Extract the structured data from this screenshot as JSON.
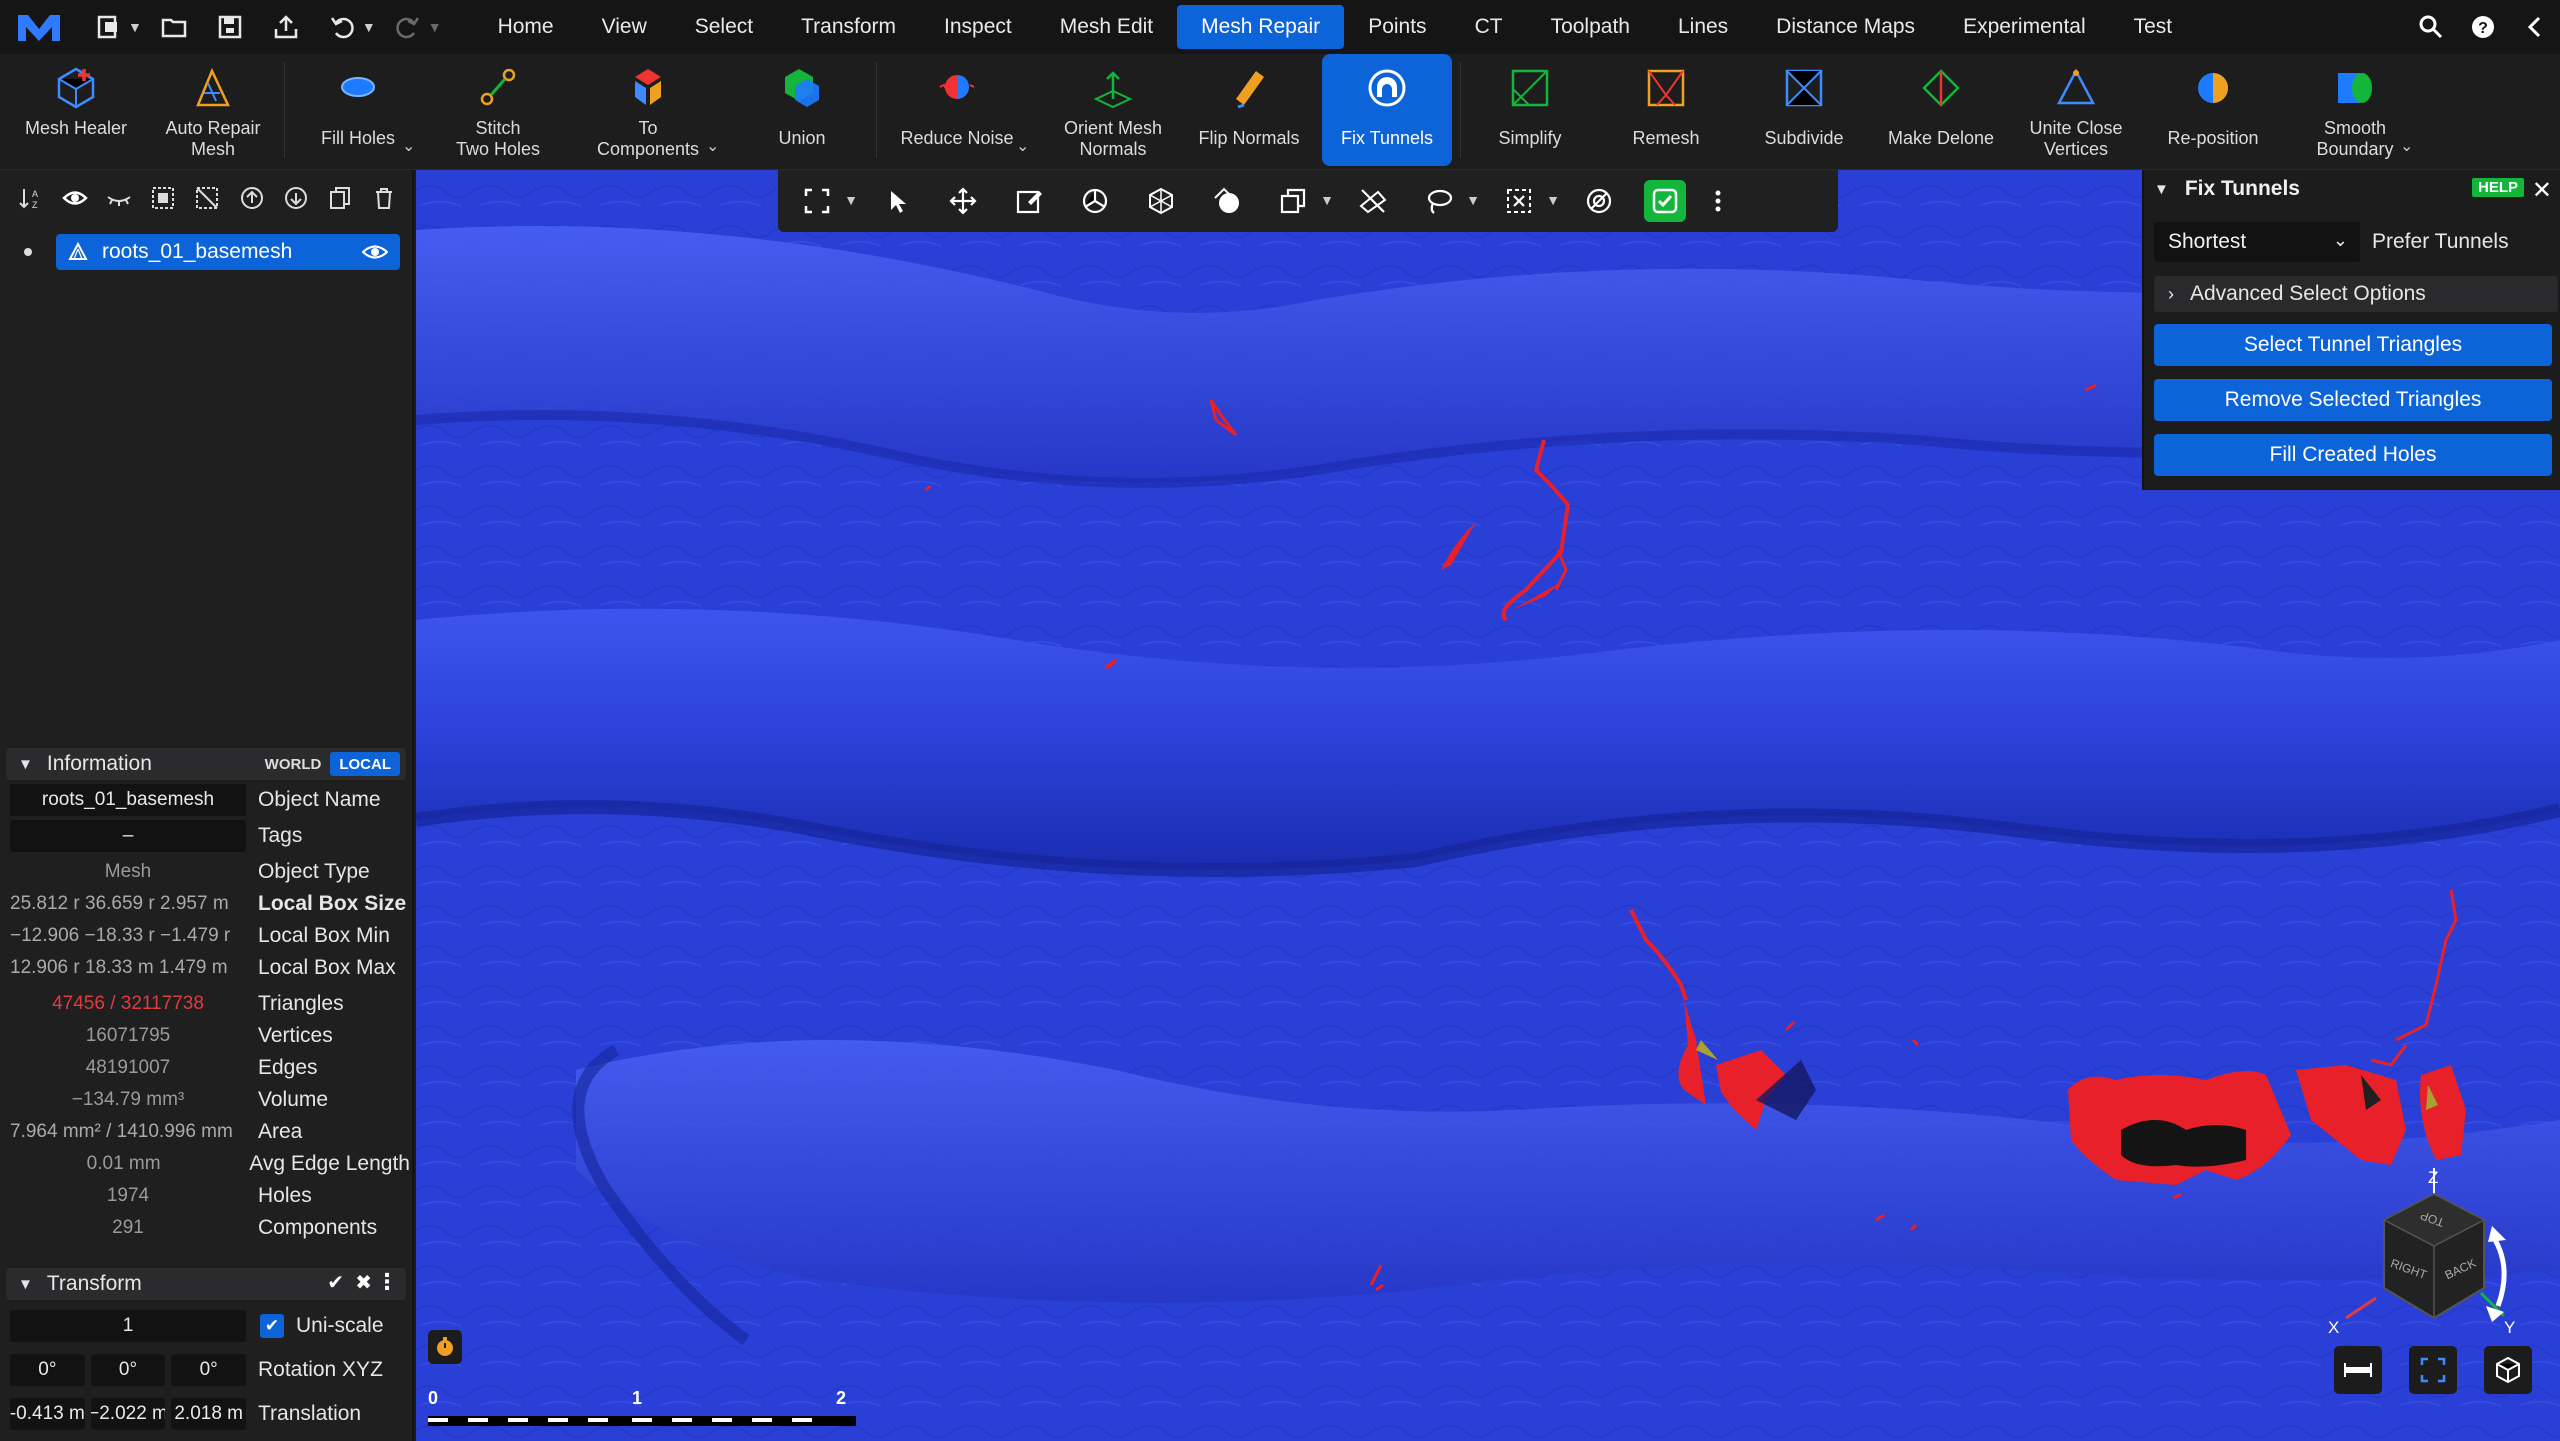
{
  "menubar": {
    "items": [
      "Home",
      "View",
      "Select",
      "Transform",
      "Inspect",
      "Mesh Edit",
      "Mesh Repair",
      "Points",
      "CT",
      "Toolpath",
      "Lines",
      "Distance Maps",
      "Experimental",
      "Test"
    ],
    "active": "Mesh Repair"
  },
  "ribbon": {
    "tools": [
      {
        "label": "Mesh Healer"
      },
      {
        "label": "Auto Repair\nMesh"
      },
      {
        "label": "Fill Holes"
      },
      {
        "label": "Stitch\nTwo Holes"
      },
      {
        "label": "To\nComponents"
      },
      {
        "label": "Union"
      },
      {
        "label": "Reduce Noise"
      },
      {
        "label": "Orient Mesh\nNormals"
      },
      {
        "label": "Flip Normals"
      },
      {
        "label": "Fix Tunnels"
      },
      {
        "label": "Simplify"
      },
      {
        "label": "Remesh"
      },
      {
        "label": "Subdivide"
      },
      {
        "label": "Make Delone"
      },
      {
        "label": "Unite Close\nVertices"
      },
      {
        "label": "Re-position"
      },
      {
        "label": "Smooth\nBoundary"
      }
    ],
    "active": "Fix Tunnels"
  },
  "scene_tree": {
    "object_name": "roots_01_basemesh"
  },
  "information": {
    "title": "Information",
    "world_label": "WORLD",
    "local_label": "LOCAL",
    "object_name_value": "roots_01_basemesh",
    "object_name_label": "Object Name",
    "tags_value": "–",
    "tags_label": "Tags",
    "object_type_value": "Mesh",
    "object_type_label": "Object Type",
    "local_box_size_value": "25.812 r 36.659 r 2.957 m",
    "local_box_size_label": "Local Box Size",
    "local_box_min_value": "−12.906 −18.33 r −1.479 r",
    "local_box_min_label": "Local Box Min",
    "local_box_max_value": "12.906 r 18.33 m 1.479 m",
    "local_box_max_label": "Local Box Max",
    "triangles_value": "47456 / 32117738",
    "triangles_label": "Triangles",
    "vertices_value": "16071795",
    "vertices_label": "Vertices",
    "edges_value": "48191007",
    "edges_label": "Edges",
    "volume_value": "−134.79 mm³",
    "volume_label": "Volume",
    "area_value": "7.964 mm² / 1410.996 mm",
    "area_label": "Area",
    "avg_edge_value": "0.01 mm",
    "avg_edge_label": "Avg Edge Length",
    "holes_value": "1974",
    "holes_label": "Holes",
    "components_value": "291",
    "components_label": "Components"
  },
  "transform": {
    "title": "Transform",
    "scale_value": "1",
    "uniscale_label": "Uni-scale",
    "rotation": [
      "0°",
      "0°",
      "0°"
    ],
    "rotation_label": "Rotation XYZ",
    "translation": [
      "-0.413 m",
      "−2.022 m",
      "2.018 m"
    ],
    "translation_label": "Translation"
  },
  "fix_tunnels": {
    "title": "Fix Tunnels",
    "help_label": "HELP",
    "mode_value": "Shortest",
    "prefer_label": "Prefer Tunnels",
    "advanced_label": "Advanced Select Options",
    "select_button": "Select Tunnel Triangles",
    "remove_button": "Remove Selected Triangles",
    "fill_button": "Fill Created Holes"
  },
  "scale_bar": {
    "ticks": [
      "0",
      "1",
      "2"
    ]
  },
  "view_cube": {
    "faces": [
      "TOP",
      "RIGHT",
      "BACK"
    ],
    "axes": [
      "Z",
      "X",
      "Y"
    ]
  },
  "colors": {
    "accent": "#0d63d8",
    "mesh": "#2a3fd6",
    "selection": "#e8202a",
    "help_badge": "#13b53b"
  }
}
